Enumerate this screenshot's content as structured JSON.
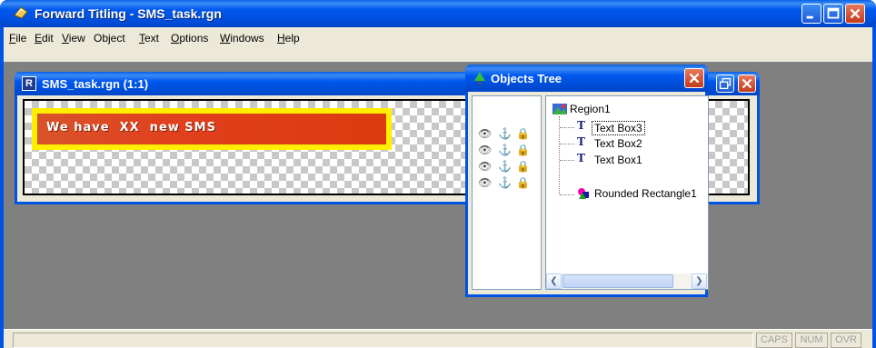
{
  "app": {
    "title": "Forward Titling - SMS_task.rgn"
  },
  "menu": {
    "items": [
      {
        "accel": "F",
        "rest": "ile"
      },
      {
        "accel": "E",
        "rest": "dit"
      },
      {
        "accel": "V",
        "rest": "iew"
      },
      {
        "accel": "",
        "pre": "",
        "label": "Object"
      },
      {
        "accel": "T",
        "rest": "ext"
      },
      {
        "accel": "O",
        "rest": "ptions"
      },
      {
        "accel": "W",
        "rest": "indows"
      },
      {
        "accel": "H",
        "rest": "elp"
      }
    ]
  },
  "document": {
    "title": "SMS_task.rgn  (1:1)",
    "icon_letter": "R",
    "banner_text": "We have  XX  new SMS",
    "colors": {
      "banner_border": "#ffee00",
      "banner_fill": "#dc3a10"
    }
  },
  "objects_tree": {
    "title": "Objects Tree",
    "root": "Region1",
    "nodes": [
      {
        "label": "Text Box3",
        "icon": "text-icon",
        "selected": true
      },
      {
        "label": "Text Box2",
        "icon": "text-icon",
        "selected": false
      },
      {
        "label": "Text Box1",
        "icon": "text-icon",
        "selected": false
      },
      {
        "label": "Rounded Rectangle1",
        "icon": "shape-icon",
        "selected": false
      }
    ],
    "row_icons": [
      "eye-icon",
      "anchor-icon",
      "lock-icon"
    ]
  },
  "status": {
    "panels": [
      "CAPS",
      "NUM",
      "OVR"
    ]
  }
}
